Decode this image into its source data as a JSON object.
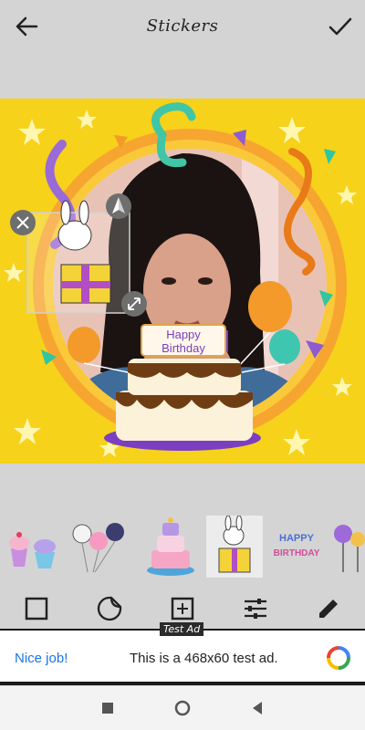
{
  "header": {
    "title": "Stickers",
    "back_icon": "arrow-left-icon",
    "done_icon": "check-icon"
  },
  "canvas": {
    "background_color": "#f6d21b",
    "cake_topper": {
      "line1": "Happy",
      "line2": "Birthday"
    }
  },
  "sticker_strip": {
    "items": [
      "cupcakes-sticker",
      "animal-balloons-sticker",
      "birthday-cake-sticker",
      "bunny-gift-sticker",
      "happy-birthday-banner-sticker",
      "lollipops-sticker"
    ],
    "banner_text": {
      "line1": "HAPPY",
      "line2": "BIRTHDAY"
    }
  },
  "toolbar": {
    "items": [
      "frame-icon",
      "sticker-icon",
      "add-image-icon",
      "adjust-icon",
      "edit-icon"
    ]
  },
  "ad": {
    "badge": "Test Ad",
    "cta": "Nice job!",
    "message": "This is a 468x60 test ad."
  },
  "system_nav": {
    "items": [
      "recents-icon",
      "home-icon",
      "back-icon"
    ]
  }
}
